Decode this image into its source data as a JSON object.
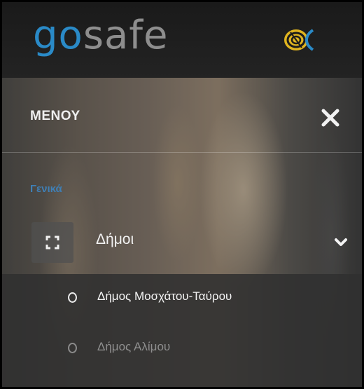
{
  "header": {
    "logo_go": "go",
    "logo_safe": "safe",
    "emblem_icon": "gosafe-emblem-icon",
    "colors": {
      "logo_go": "#2a8ac7",
      "logo_safe": "#8e8e8e",
      "emblem": "#e0b41f"
    }
  },
  "menu": {
    "title": "ΜΕΝΟΥ",
    "close_icon": "close-icon",
    "section_label": "Γενικά",
    "section_color": "#3f7fb5",
    "item": {
      "label": "Δήμοι",
      "icon": "expand-icon",
      "toggle_icon": "chevron-down-icon",
      "expanded": true
    },
    "subitems": [
      {
        "label": "Δήμος Μοσχάτου-Ταύρου",
        "active": true
      },
      {
        "label": "Δήμος Αλίμου",
        "active": false
      }
    ]
  }
}
